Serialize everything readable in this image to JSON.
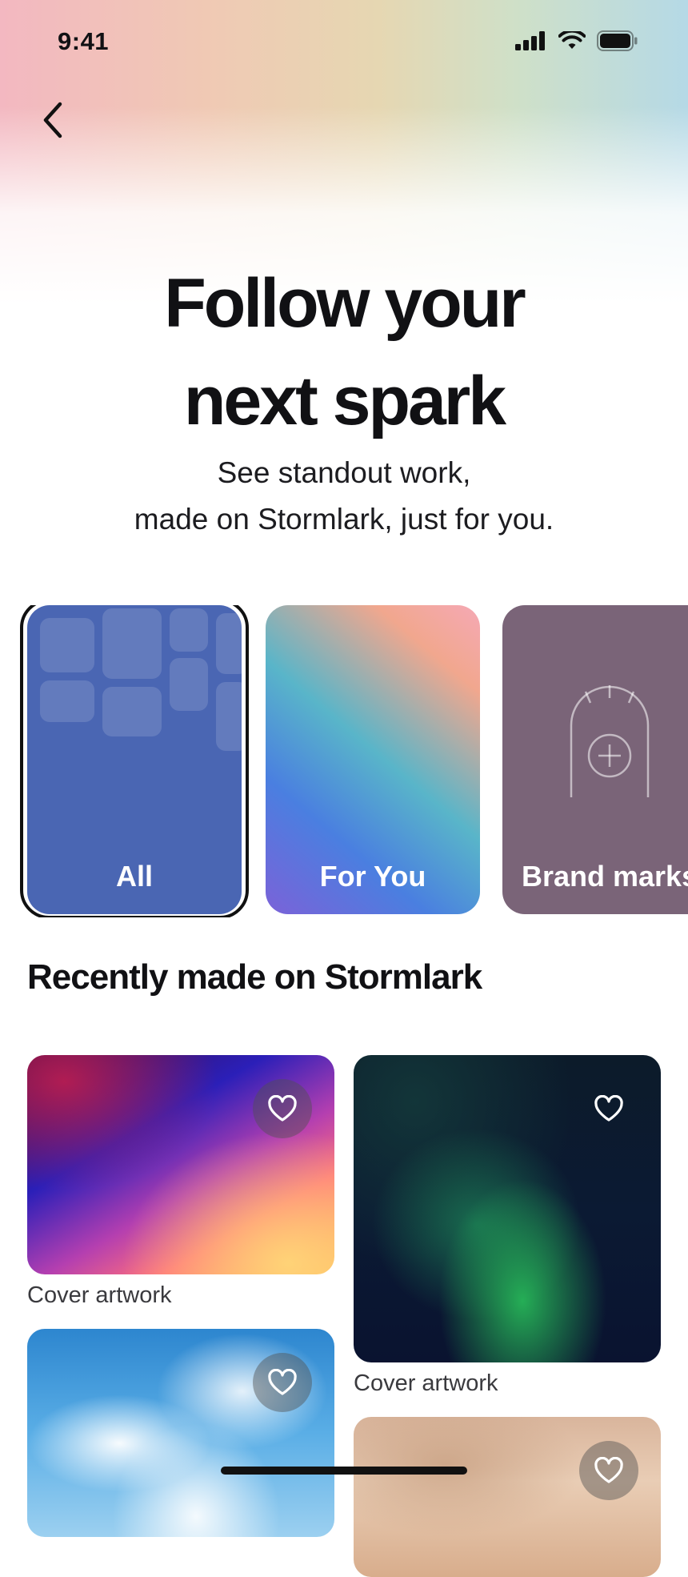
{
  "status_bar": {
    "time": "9:41"
  },
  "hero": {
    "title_line1": "Follow your",
    "title_line2": "next spark",
    "subtitle_line1": "See standout work,",
    "subtitle_line2": "made on Stormlark, just for you."
  },
  "categories": [
    {
      "label": "All",
      "selected": true,
      "color": "#4a66b3"
    },
    {
      "label": "For You",
      "selected": false
    },
    {
      "label": "Brand marks",
      "selected": false,
      "color": "#7a6478"
    }
  ],
  "section": {
    "title": "Recently made on Stormlark"
  },
  "artworks": [
    {
      "caption": "Cover artwork",
      "favorited": false
    },
    {
      "caption": "Cover artwork",
      "favorited": false
    },
    {
      "caption": "",
      "favorited": false
    },
    {
      "caption": "",
      "favorited": false
    }
  ],
  "icons": {
    "back": "chevron-left-icon",
    "heart": "heart-outline-icon",
    "signal": "cellular-signal-icon",
    "wifi": "wifi-icon",
    "battery": "battery-icon"
  }
}
